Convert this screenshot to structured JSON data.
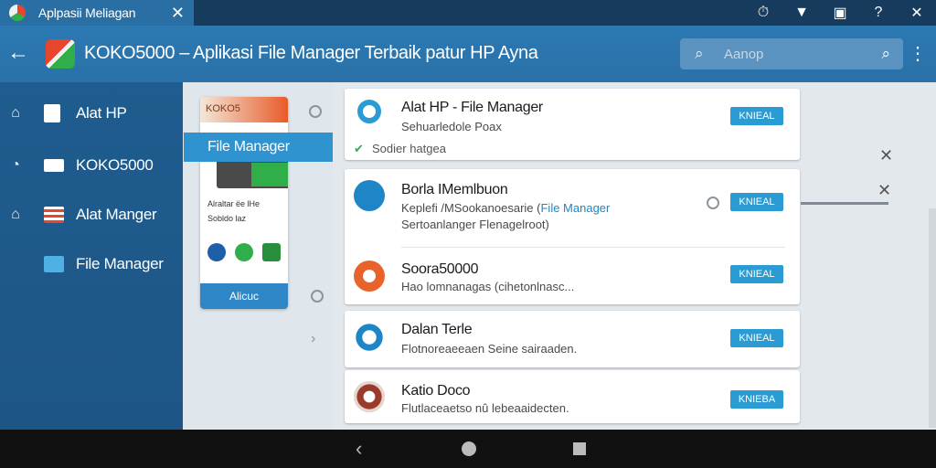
{
  "tab": {
    "title": "Aplpasii Meliagan",
    "close_icon": "close-icon"
  },
  "status_icons": [
    "alarm-icon",
    "wifi-icon",
    "nfc-icon",
    "help-icon",
    "close-icon"
  ],
  "appbar": {
    "title": "KOKO5000 – Aplikasi File Manager Terbaik patur HP Ayna",
    "search_placeholder": "Aanop"
  },
  "sidebar": {
    "items": [
      {
        "label": "Alat HP",
        "icon": "home-icon",
        "color": "#ffffff"
      },
      {
        "label": "KOKO5000",
        "icon": "mail-icon",
        "color": "#ffffff"
      },
      {
        "label": "Alat Manger",
        "icon": "list-icon",
        "color": "#e8462c"
      },
      {
        "label": "File Manager",
        "icon": "folder-icon",
        "color": "#4fb0e6"
      }
    ]
  },
  "preview": {
    "header": "KOKO5",
    "highlight": "File Manager",
    "line1": "Alraltar ëe lHe",
    "line2": "Sobldo laz",
    "button": "Alicuc"
  },
  "rows": [
    {
      "title": "Alat HP - File Manager",
      "subtitle": "Sehuarledole Poax",
      "status": "Sodier hatgea",
      "button": "KNIEAL"
    },
    {
      "title": "Borla IMemlbuon",
      "subtitle_prefix": "Keplefi /MSookanoesarie (",
      "subtitle_link": "File Manager",
      "subtitle_line2": "Sertoanlanger Flenagelroot)",
      "button": "KNIEAL"
    },
    {
      "title": "Soora50000",
      "subtitle": "Hao lomnanagas (cihetonlnasc...",
      "button": "KNIEAL"
    },
    {
      "title": "Dalan Terle",
      "subtitle": "Flotnoreaeeaen Seine sairaaden.",
      "button": "KNIEAL"
    },
    {
      "title": "Katio Doco",
      "subtitle": "Flutlaceaetso nû lebeaaidecten.",
      "button": "KNIEBA"
    }
  ],
  "colors": {
    "primary": "#2a71a8",
    "sidebar": "#1f5c8f",
    "accent": "#2b9bd3"
  }
}
